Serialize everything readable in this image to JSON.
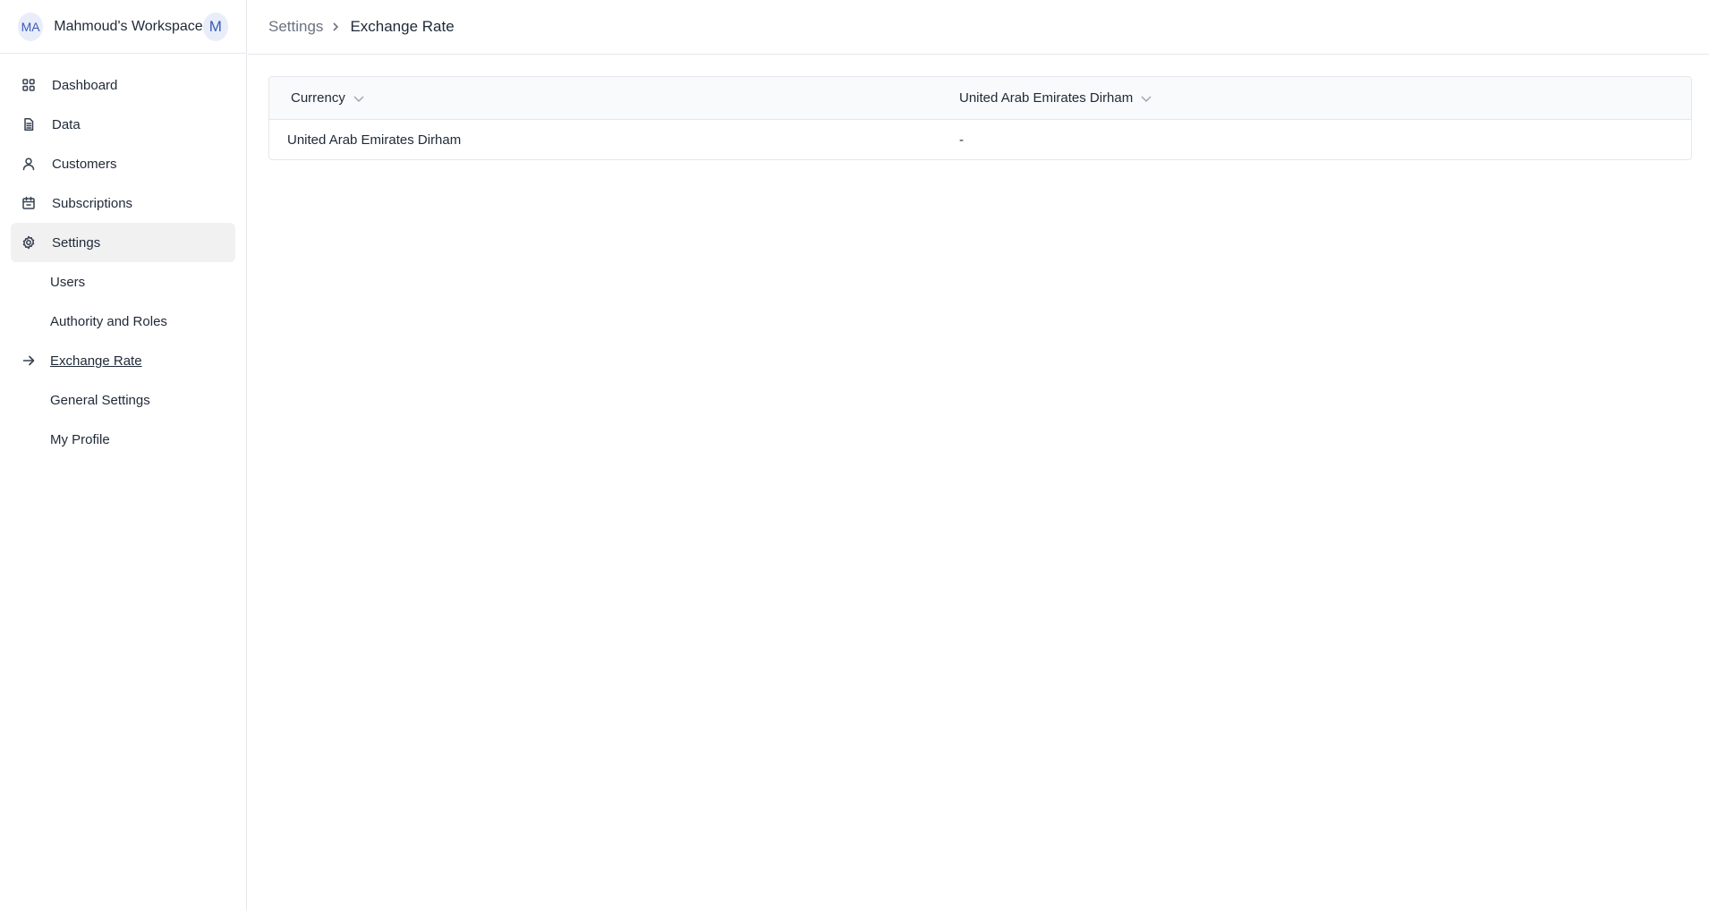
{
  "workspace": {
    "initials": "MA",
    "name": "Mahmoud's Workspace",
    "avatar_letter": "M"
  },
  "sidebar": {
    "items": [
      {
        "label": "Dashboard",
        "icon": "grid-icon"
      },
      {
        "label": "Data",
        "icon": "document-icon"
      },
      {
        "label": "Customers",
        "icon": "user-icon"
      },
      {
        "label": "Subscriptions",
        "icon": "calendar-icon"
      },
      {
        "label": "Settings",
        "icon": "gear-icon"
      }
    ],
    "settings_subitems": [
      {
        "label": "Users"
      },
      {
        "label": "Authority and Roles"
      },
      {
        "label": "Exchange Rate"
      },
      {
        "label": "General Settings"
      },
      {
        "label": "My Profile"
      }
    ]
  },
  "breadcrumb": {
    "parent": "Settings",
    "current": "Exchange Rate"
  },
  "table": {
    "headers": [
      "Currency",
      "United Arab Emirates Dirham"
    ],
    "rows": [
      [
        "United Arab Emirates Dirham",
        "-"
      ]
    ]
  }
}
